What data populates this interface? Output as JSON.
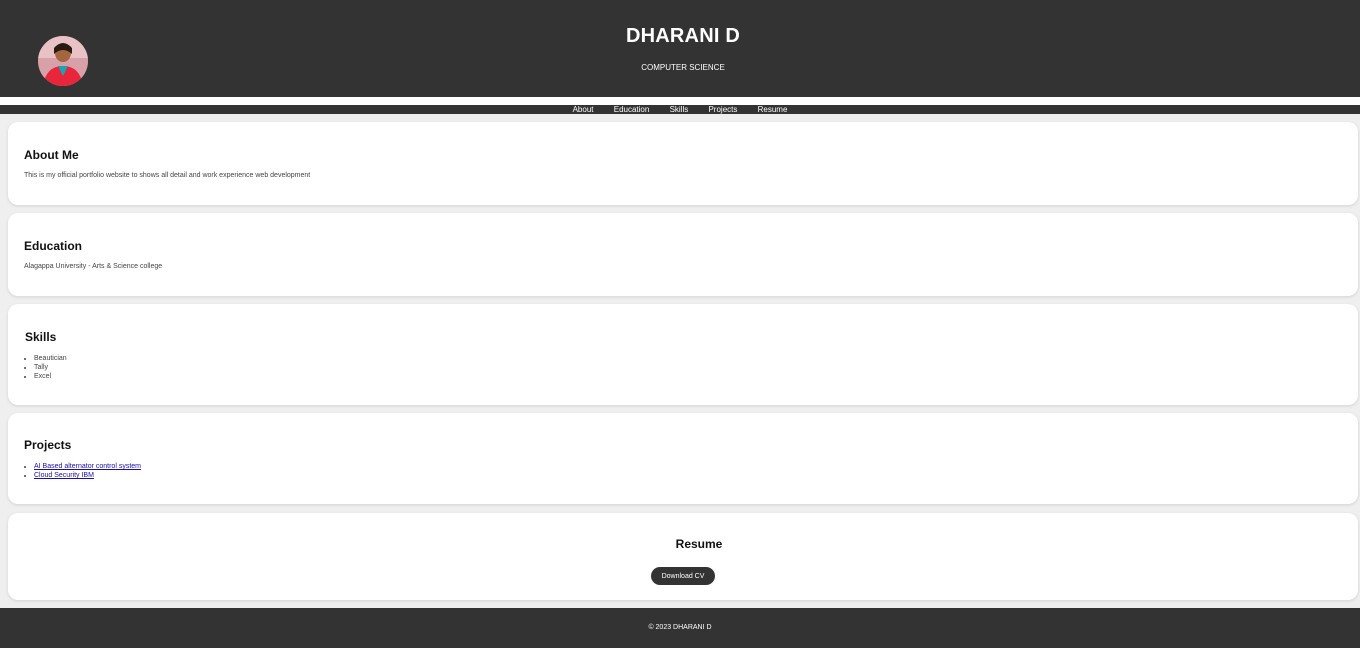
{
  "header": {
    "name": "DHARANI D",
    "subtitle": "COMPUTER SCIENCE"
  },
  "nav": {
    "items": [
      {
        "label": "About"
      },
      {
        "label": "Education"
      },
      {
        "label": "Skills"
      },
      {
        "label": "Projects"
      },
      {
        "label": "Resume"
      }
    ]
  },
  "about": {
    "title": "About Me",
    "text": "This is my official portfolio website to shows all detail and work experience web development"
  },
  "education": {
    "title": "Education",
    "text": "Alagappa University - Arts & Science college"
  },
  "skills": {
    "title": "Skills",
    "items": [
      "Beautician",
      "Tally",
      "Excel"
    ]
  },
  "projects": {
    "title": "Projects",
    "items": [
      "AI Based alternator control system",
      "Cloud Security IBM"
    ]
  },
  "resume": {
    "title": "Resume",
    "button_label": "Download CV"
  },
  "footer": {
    "text": "© 2023 DHARANI D"
  },
  "colors": {
    "header_bg": "#333333",
    "page_bg": "#efefef",
    "card_bg": "#ffffff",
    "link": "#1a0dab"
  }
}
